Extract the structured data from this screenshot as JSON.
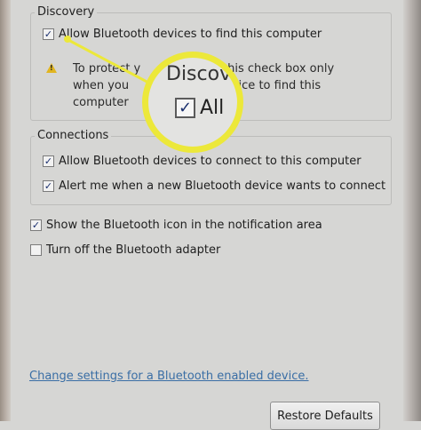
{
  "discovery": {
    "title": "Discovery",
    "allow_find_label": "Allow Bluetooth devices to find this computer",
    "allow_find_checked": true,
    "warning_line1": "To protect your privacy, select this check box only",
    "warning_line1_visible": "To protect y",
    "warning_line1_tail": "select this check box only",
    "warning_line2_visible": "when you",
    "warning_line2_tail": "th device to find this",
    "warning_line3_visible": "computer"
  },
  "connections": {
    "title": "Connections",
    "allow_connect_label": "Allow Bluetooth devices to connect to this computer",
    "allow_connect_checked": true,
    "alert_label": "Alert me when a new Bluetooth device wants to connect",
    "alert_checked": true
  },
  "options": {
    "show_icon_label": "Show the Bluetooth icon in the notification area",
    "show_icon_checked": true,
    "turn_off_label": "Turn off the Bluetooth adapter",
    "turn_off_checked": false
  },
  "link": {
    "change_settings": "Change settings for a Bluetooth enabled device."
  },
  "buttons": {
    "restore_defaults": "Restore Defaults"
  },
  "magnifier": {
    "title": "Discov",
    "text": "All"
  },
  "colors": {
    "highlight": "#ece83a",
    "link": "#3a6ea5",
    "warning": "#e1b520"
  },
  "icons": {
    "check": "✓",
    "warning": "warning-icon"
  }
}
